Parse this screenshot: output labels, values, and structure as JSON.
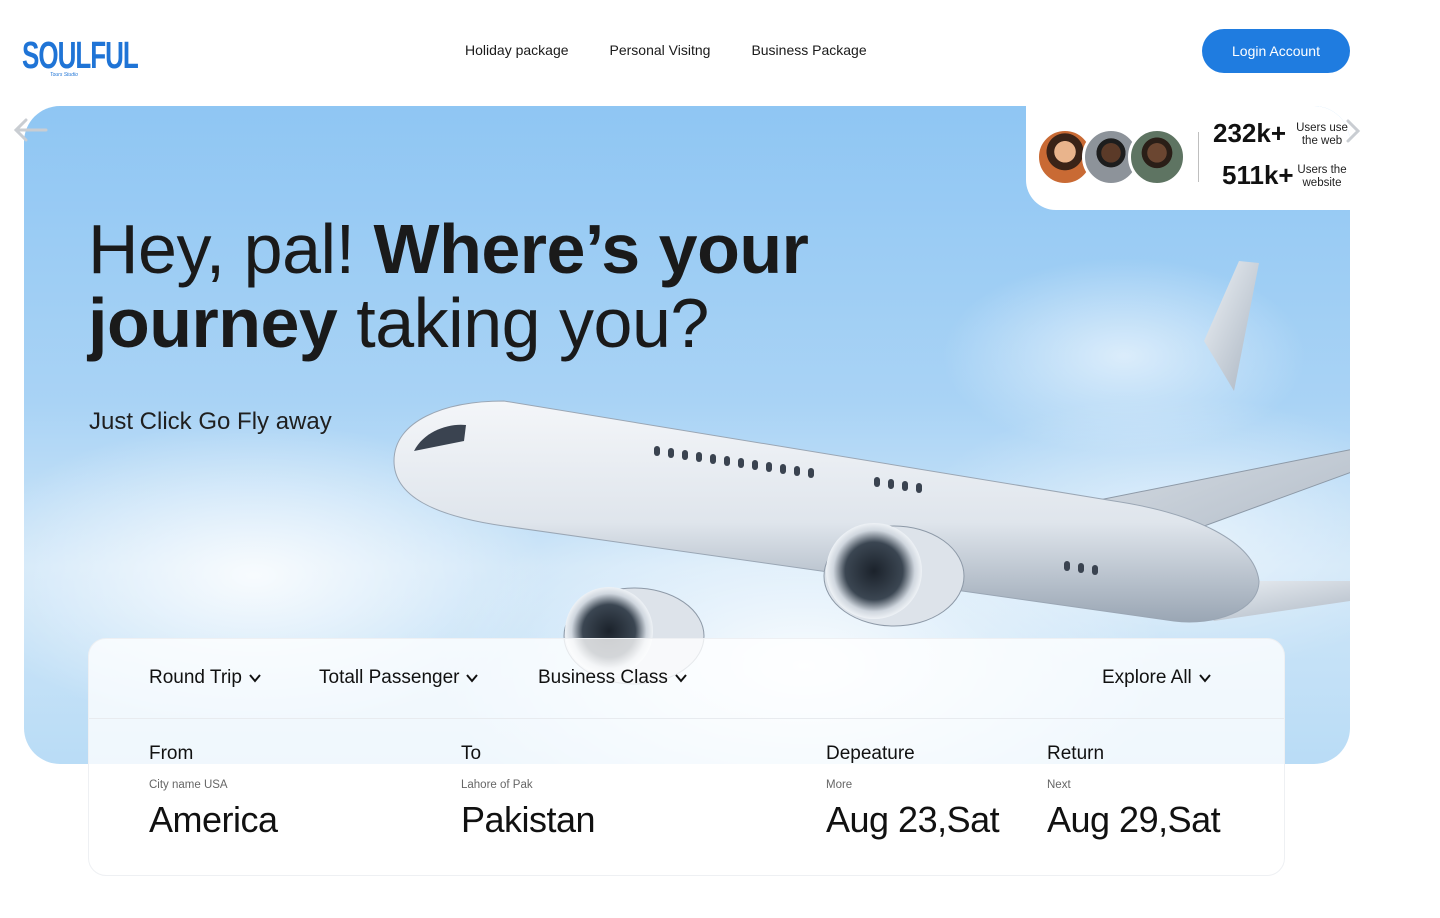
{
  "brand": {
    "logo_text": "SOULFUL",
    "logo_subtext": "Tours Studio",
    "accent": "#1f7ce0"
  },
  "nav": {
    "items": [
      "Holiday package",
      "Personal Visitng",
      "Business Package"
    ]
  },
  "header": {
    "login_label": "Login Account"
  },
  "stats": [
    {
      "value": "232k+",
      "label": "Users use the web"
    },
    {
      "value": "511k+",
      "label": "Users the website"
    }
  ],
  "hero": {
    "headline_light_1": "Hey, pal! ",
    "headline_bold_1": "Where’s your",
    "headline_bold_2": "journey",
    "headline_light_2": " taking you?",
    "tagline": "Just Click Go Fly away"
  },
  "search": {
    "dropdowns": [
      "Round Trip",
      "Totall Passenger",
      "Business Class"
    ],
    "explore_label": "Explore All",
    "fields": [
      {
        "label": "From",
        "sub": "City name USA",
        "value": "America"
      },
      {
        "label": "To",
        "sub": "Lahore of Pak",
        "value": "Pakistan"
      },
      {
        "label": "Depeature",
        "sub": "More",
        "value": "Aug 23,Sat"
      },
      {
        "label": "Return",
        "sub": "Next",
        "value": "Aug 29,Sat"
      }
    ]
  },
  "icons": {
    "left_arrow": "arrow-left-icon",
    "right_arrow": "chevron-right-icon",
    "dropdown": "chevron-down-icon"
  }
}
